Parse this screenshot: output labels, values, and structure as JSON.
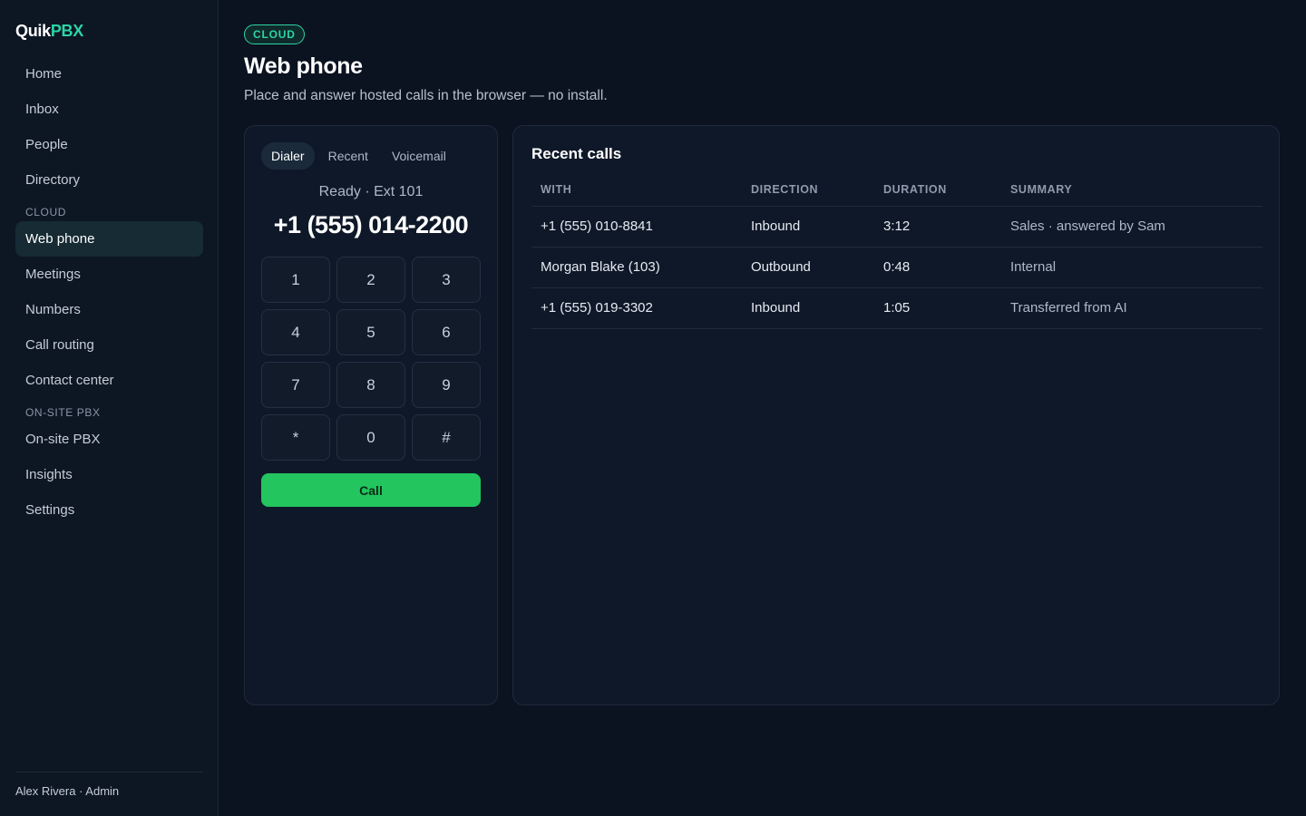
{
  "brand": {
    "part1": "Quik",
    "part2": "PBX"
  },
  "sidebar": {
    "items_top": [
      {
        "label": "Home"
      },
      {
        "label": "Inbox"
      },
      {
        "label": "People"
      },
      {
        "label": "Directory"
      }
    ],
    "section_cloud": "CLOUD",
    "items_cloud": [
      {
        "label": "Web phone",
        "active": true
      },
      {
        "label": "Meetings"
      },
      {
        "label": "Numbers"
      },
      {
        "label": "Call routing"
      },
      {
        "label": "Contact center"
      }
    ],
    "section_onsite": "ON-SITE PBX",
    "items_onsite": [
      {
        "label": "On-site PBX"
      },
      {
        "label": "Insights"
      },
      {
        "label": "Settings"
      }
    ],
    "footer": "Alex Rivera · Admin"
  },
  "header": {
    "badge": "CLOUD",
    "title": "Web phone",
    "subtitle": "Place and answer hosted calls in the browser — no install."
  },
  "dialer": {
    "tabs": [
      "Dialer",
      "Recent",
      "Voicemail"
    ],
    "active_tab": "Dialer",
    "status": "Ready · Ext 101",
    "number": "+1 (555) 014-2200",
    "keys": [
      "1",
      "2",
      "3",
      "4",
      "5",
      "6",
      "7",
      "8",
      "9",
      "*",
      "0",
      "#"
    ],
    "call_label": "Call"
  },
  "recent_calls": {
    "title": "Recent calls",
    "columns": [
      "WITH",
      "DIRECTION",
      "DURATION",
      "SUMMARY"
    ],
    "rows": [
      [
        "+1 (555) 010-8841",
        "Inbound",
        "3:12",
        "Sales · answered by Sam"
      ],
      [
        "Morgan Blake (103)",
        "Outbound",
        "0:48",
        "Internal"
      ],
      [
        "+1 (555) 019-3302",
        "Inbound",
        "1:05",
        "Transferred from AI"
      ]
    ]
  },
  "colors": {
    "accent": "#2dd4a6",
    "call_button": "#22c55e",
    "background": "#0b1220"
  }
}
